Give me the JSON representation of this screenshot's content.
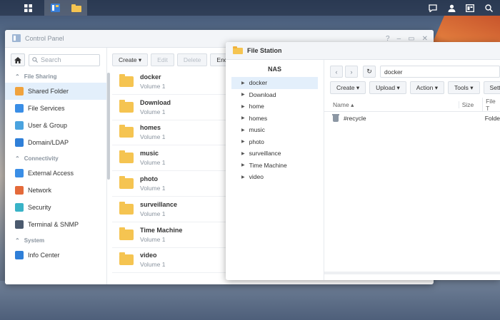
{
  "taskbar": {
    "left": [
      {
        "name": "main-menu-icon"
      },
      {
        "name": "control-panel-taskbar-icon"
      },
      {
        "name": "file-station-taskbar-icon"
      }
    ],
    "right": [
      {
        "name": "chat-icon"
      },
      {
        "name": "user-icon"
      },
      {
        "name": "widgets-icon"
      },
      {
        "name": "search-icon"
      }
    ]
  },
  "control_panel": {
    "title": "Control Panel",
    "search_placeholder": "Search",
    "sections": [
      {
        "label": "File Sharing",
        "items": [
          {
            "label": "Shared Folder",
            "color": "#f0a23c",
            "selected": true
          },
          {
            "label": "File Services",
            "color": "#3a8ee6"
          },
          {
            "label": "User & Group",
            "color": "#4aa3df"
          },
          {
            "label": "Domain/LDAP",
            "color": "#2f7fd8"
          }
        ]
      },
      {
        "label": "Connectivity",
        "items": [
          {
            "label": "External Access",
            "color": "#3a8ee6"
          },
          {
            "label": "Network",
            "color": "#e46a3a"
          },
          {
            "label": "Security",
            "color": "#39b3c7"
          },
          {
            "label": "Terminal & SNMP",
            "color": "#4b5a6e"
          }
        ]
      },
      {
        "label": "System",
        "items": [
          {
            "label": "Info Center",
            "color": "#2f7fd8"
          }
        ]
      }
    ],
    "toolbar": {
      "create": "Create",
      "edit": "Edit",
      "delete": "Delete",
      "encrypt": "Encr"
    },
    "folders": [
      {
        "name": "docker",
        "volume": "Volume 1"
      },
      {
        "name": "Download",
        "volume": "Volume 1"
      },
      {
        "name": "homes",
        "volume": "Volume 1"
      },
      {
        "name": "music",
        "volume": "Volume 1"
      },
      {
        "name": "photo",
        "volume": "Volume 1"
      },
      {
        "name": "surveillance",
        "volume": "Volume 1"
      },
      {
        "name": "Time Machine",
        "volume": "Volume 1"
      },
      {
        "name": "video",
        "volume": "Volume 1"
      }
    ]
  },
  "file_station": {
    "title": "File Station",
    "tree_root": "NAS",
    "tree": [
      "docker",
      "Download",
      "home",
      "homes",
      "music",
      "photo",
      "surveillance",
      "Time Machine",
      "video"
    ],
    "path": "docker",
    "toolbar": {
      "create": "Create",
      "upload": "Upload",
      "action": "Action",
      "tools": "Tools",
      "settings": "Settin"
    },
    "columns": {
      "name": "Name",
      "size": "Size",
      "type": "File T"
    },
    "files": [
      {
        "name": "#recycle",
        "type": "Folde"
      }
    ]
  }
}
